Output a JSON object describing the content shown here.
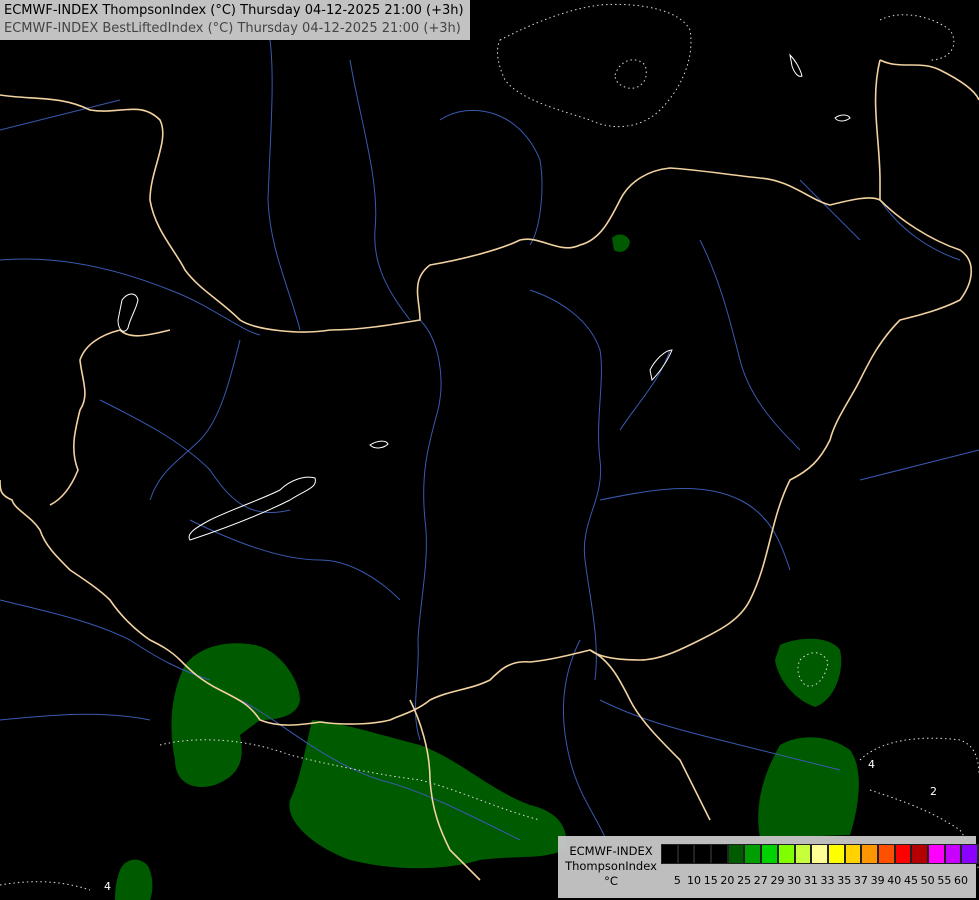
{
  "header": {
    "line1": "ECMWF-INDEX ThompsonIndex (°C) Thursday 04-12-2025 21:00 (+3h)",
    "line2": "ECMWF-INDEX BestLiftedIndex (°C) Thursday 04-12-2025 21:00 (+3h)"
  },
  "legend": {
    "model": "ECMWF-INDEX",
    "parameter": "ThompsonIndex",
    "unit": "°C",
    "colors": [
      "#000000",
      "#000000",
      "#000000",
      "#000000",
      "#005a00",
      "#009e00",
      "#00d200",
      "#7fff00",
      "#c8ff3c",
      "#ffff96",
      "#ffff00",
      "#ffd200",
      "#ff9600",
      "#ff5000",
      "#ff0000",
      "#b40000",
      "#ff00ff",
      "#c800ff",
      "#8c00ff",
      "#5000ff",
      "#0000ff"
    ],
    "ticks": [
      "5",
      "10",
      "15",
      "20",
      "25",
      "27",
      "29",
      "30",
      "31",
      "33",
      "35",
      "37",
      "39",
      "40",
      "45",
      "50",
      "55",
      "60"
    ]
  },
  "map": {
    "contour_labels": [
      "4",
      "2",
      "4"
    ]
  }
}
